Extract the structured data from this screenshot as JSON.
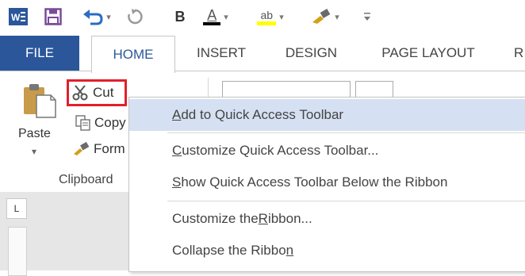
{
  "quick_access": {
    "app_icon_label": "W≡",
    "bold_label": "B",
    "font_color_label": "A",
    "highlight_label": "ab",
    "undo_icon": "undo-icon",
    "redo_icon": "redo-icon",
    "save_icon": "save-icon",
    "painter_icon": "format-painter-icon",
    "customize_icon": "customize-qat-icon"
  },
  "tabs": [
    {
      "label": "FILE"
    },
    {
      "label": "HOME"
    },
    {
      "label": "INSERT"
    },
    {
      "label": "DESIGN"
    },
    {
      "label": "PAGE LAYOUT"
    },
    {
      "label": "R"
    }
  ],
  "clipboard": {
    "paste_label": "Paste",
    "paste_chevron": "▾",
    "cut_label": "Cut",
    "copy_label": "Copy",
    "format_label": "Form",
    "group_label": "Clipboard"
  },
  "ruler_button_label": "L",
  "context_menu": {
    "items": [
      {
        "pre": "",
        "ul": "A",
        "post": "dd to Quick Access Toolbar"
      },
      {
        "pre": "",
        "ul": "C",
        "post": "ustomize Quick Access Toolbar..."
      },
      {
        "pre": "",
        "ul": "S",
        "post": "how Quick Access Toolbar Below the Ribbon"
      },
      {
        "pre": "Customize the ",
        "ul": "R",
        "post": "ibbon..."
      },
      {
        "pre": "Collapse the Ribbo",
        "ul": "n",
        "post": ""
      }
    ]
  },
  "colors": {
    "file_tab": "#2b579a",
    "highlight_row": "#d5e1f2",
    "cut_outline": "#e0202c",
    "font_color_bar": "#000000",
    "highlight_bar": "#ffff00"
  }
}
